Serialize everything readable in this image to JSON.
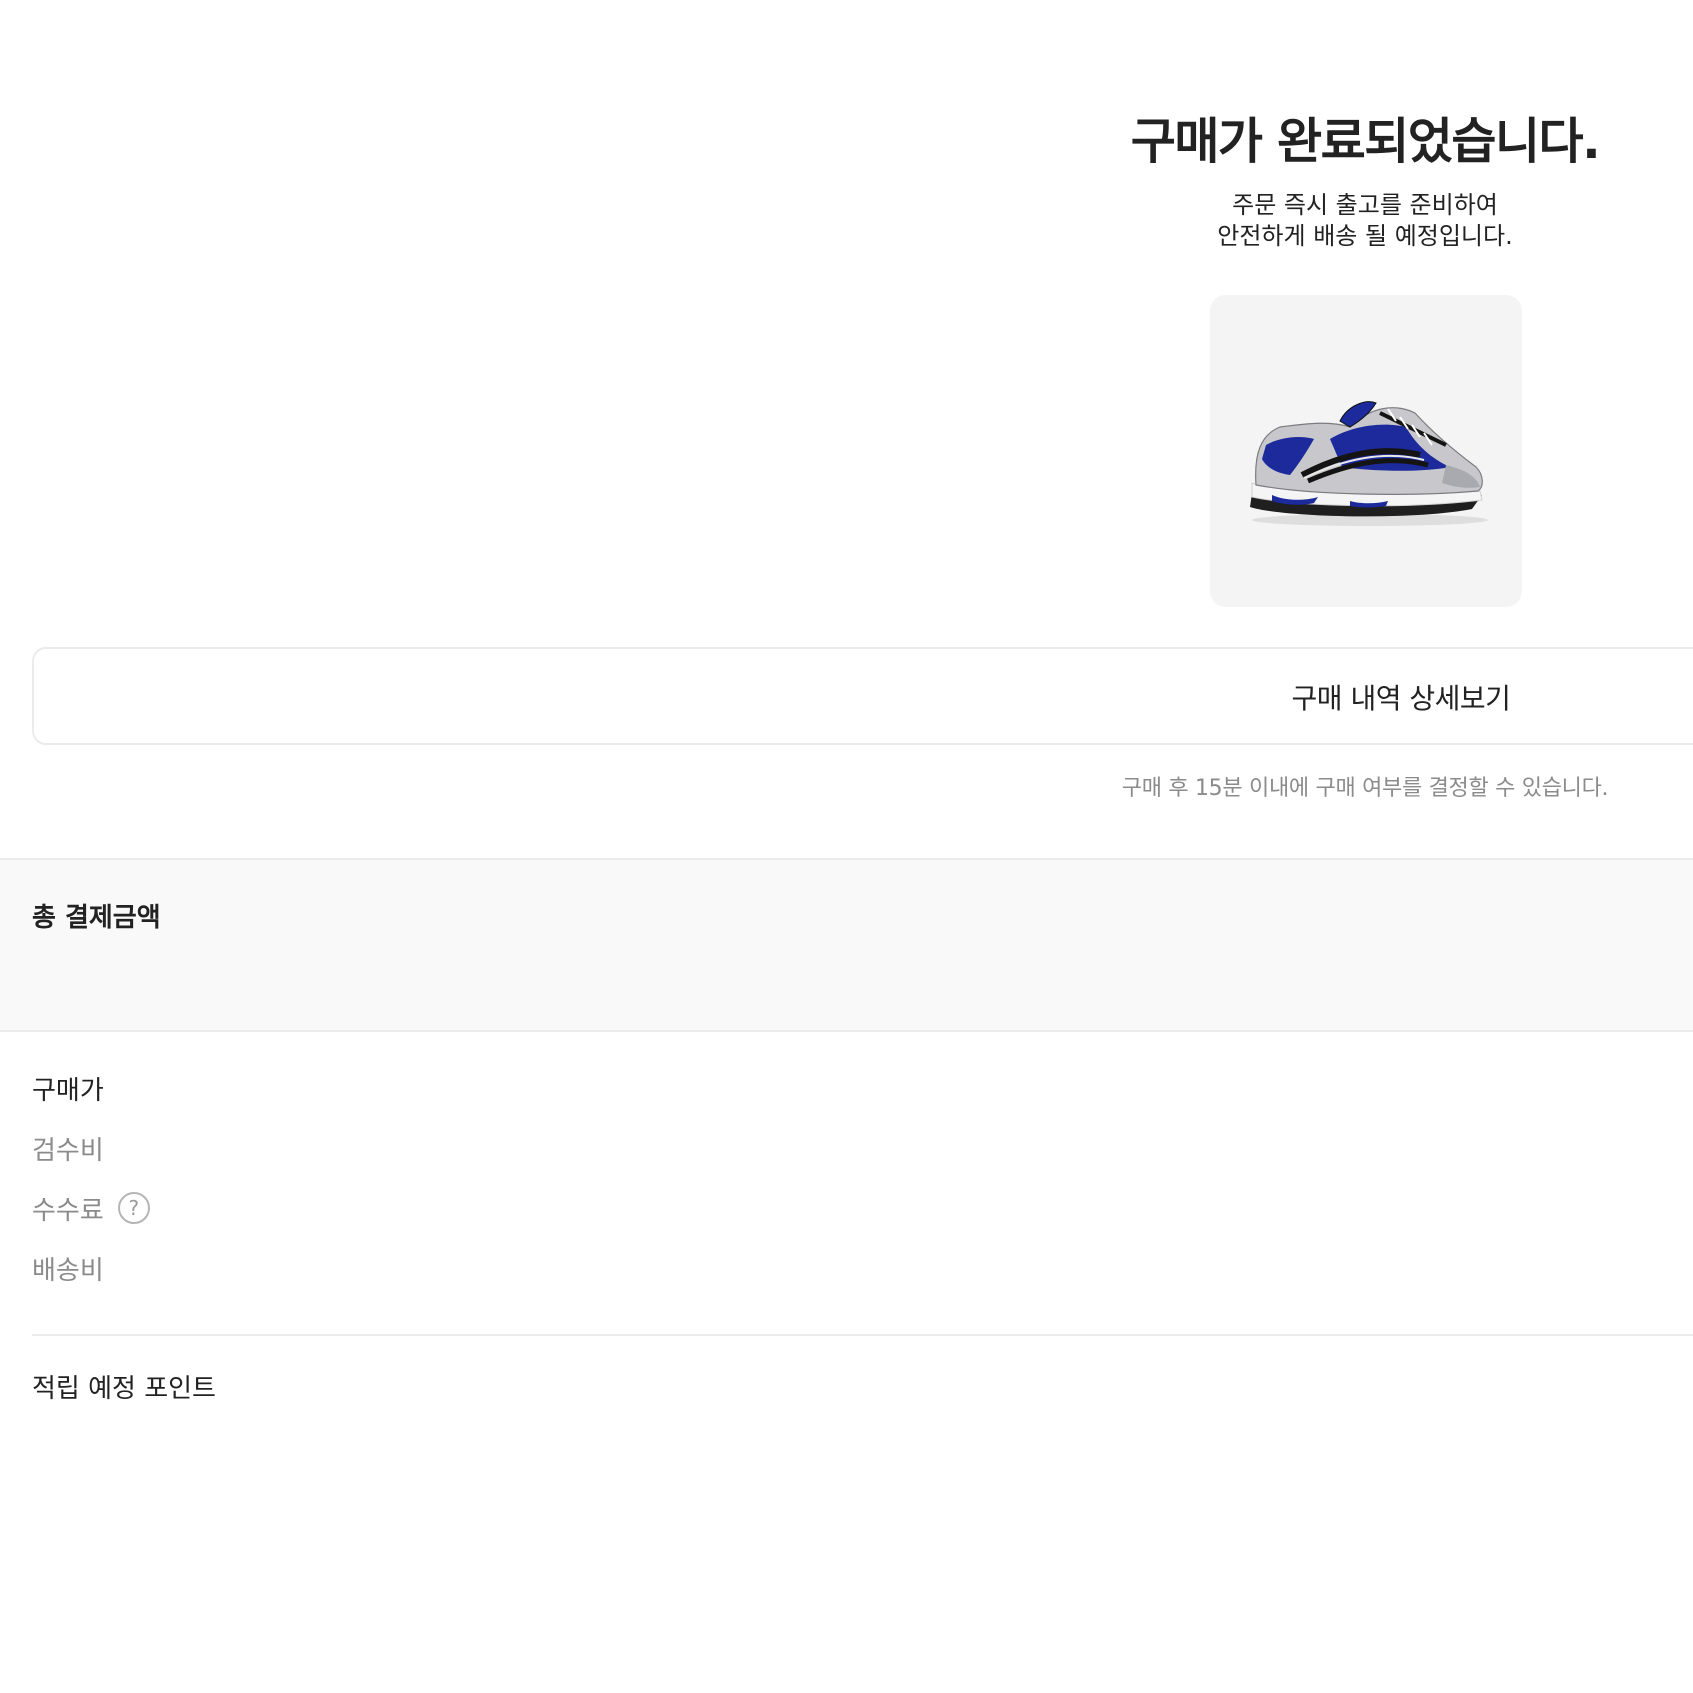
{
  "completion": {
    "title": "구매가 완료되었습니다.",
    "subtitle_line1": "주문 즉시 출고를 준비하여",
    "subtitle_line2": "안전하게 배송 될 예정입니다."
  },
  "product": {
    "image_icon": "sneaker-image",
    "colors": {
      "card_background": "#f4f4f4",
      "shoe_primary": "#1c2a9c",
      "shoe_silver": "#c8c8cc",
      "shoe_black": "#141414"
    }
  },
  "actions": {
    "detail_button_label": "구매 내역 상세보기"
  },
  "notice": {
    "text": "구매 후 15분 이내에 구매 여부를 결정할 수 있습니다."
  },
  "summary": {
    "total_label": "총 결제금액",
    "rows": [
      {
        "label": "구매가"
      },
      {
        "label": "검수비"
      },
      {
        "label": "수수료",
        "help_icon": "question-circle-icon",
        "help_glyph": "?"
      },
      {
        "label": "배송비"
      }
    ],
    "points_label": "적립 예정 포인트"
  }
}
